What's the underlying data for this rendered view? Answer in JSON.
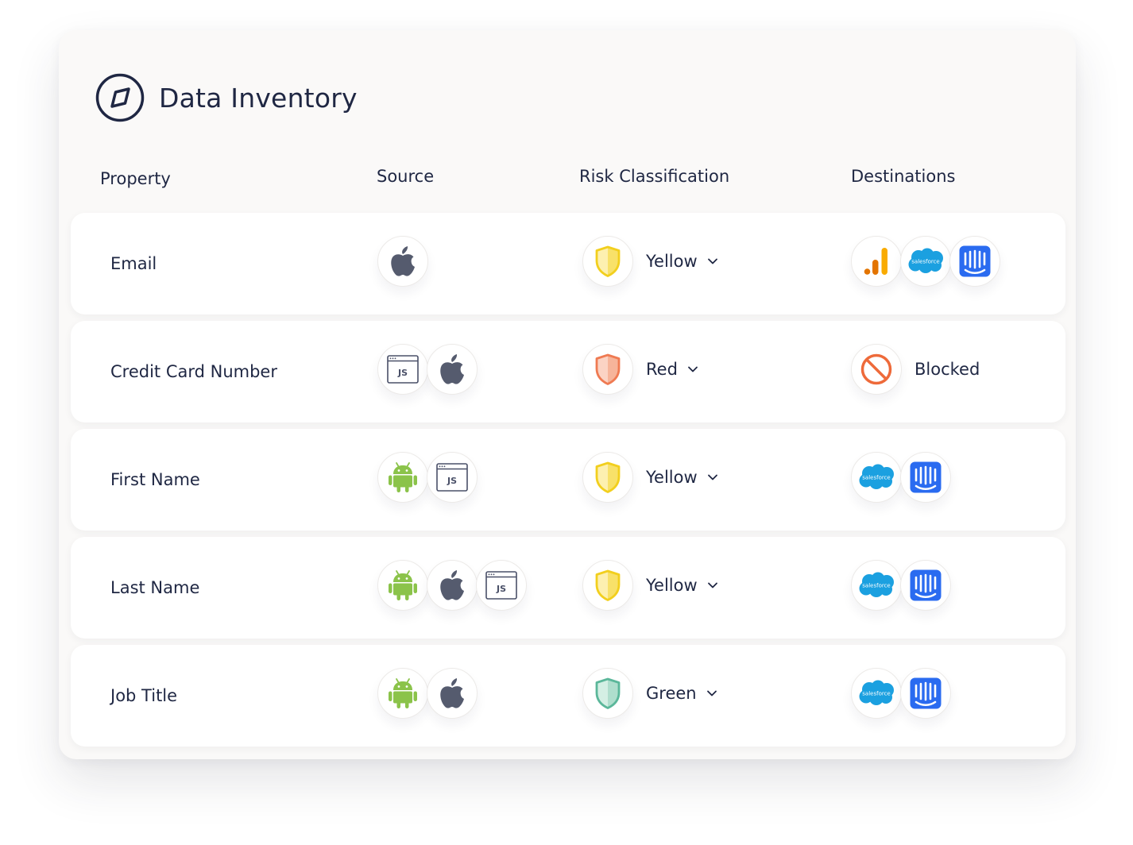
{
  "app": {
    "title": "Data Inventory",
    "title_icon": "compass-icon"
  },
  "columns": {
    "property": "Property",
    "source": "Source",
    "risk": "Risk Classification",
    "destinations": "Destinations"
  },
  "colors": {
    "yellow": "#f2cf1e",
    "red": "#ef7a52",
    "green": "#5bb79a",
    "blocked": "#ee6a3a",
    "salesforce": "#1ba0e0",
    "intercom": "#2a6bf0",
    "android": "#8bc34a",
    "apple": "#555b6e"
  },
  "rows": [
    {
      "property": "Email",
      "sources": [
        "apple-icon"
      ],
      "risk": {
        "level": "yellow",
        "label": "Yellow"
      },
      "destinations": [
        "google-analytics-icon",
        "salesforce-icon",
        "intercom-icon"
      ],
      "destination_status": ""
    },
    {
      "property": "Credit Card Number",
      "sources": [
        "javascript-icon",
        "apple-icon"
      ],
      "risk": {
        "level": "red",
        "label": "Red"
      },
      "destinations": [
        "blocked-icon"
      ],
      "destination_status": "Blocked"
    },
    {
      "property": "First Name",
      "sources": [
        "android-icon",
        "javascript-icon"
      ],
      "risk": {
        "level": "yellow",
        "label": "Yellow"
      },
      "destinations": [
        "salesforce-icon",
        "intercom-icon"
      ],
      "destination_status": ""
    },
    {
      "property": "Last Name",
      "sources": [
        "android-icon",
        "apple-icon",
        "javascript-icon"
      ],
      "risk": {
        "level": "yellow",
        "label": "Yellow"
      },
      "destinations": [
        "salesforce-icon",
        "intercom-icon"
      ],
      "destination_status": ""
    },
    {
      "property": "Job Title",
      "sources": [
        "android-icon",
        "apple-icon"
      ],
      "risk": {
        "level": "green",
        "label": "Green"
      },
      "destinations": [
        "salesforce-icon",
        "intercom-icon"
      ],
      "destination_status": ""
    }
  ],
  "labels": {
    "javascript": "JS",
    "salesforce": "salesforce"
  }
}
